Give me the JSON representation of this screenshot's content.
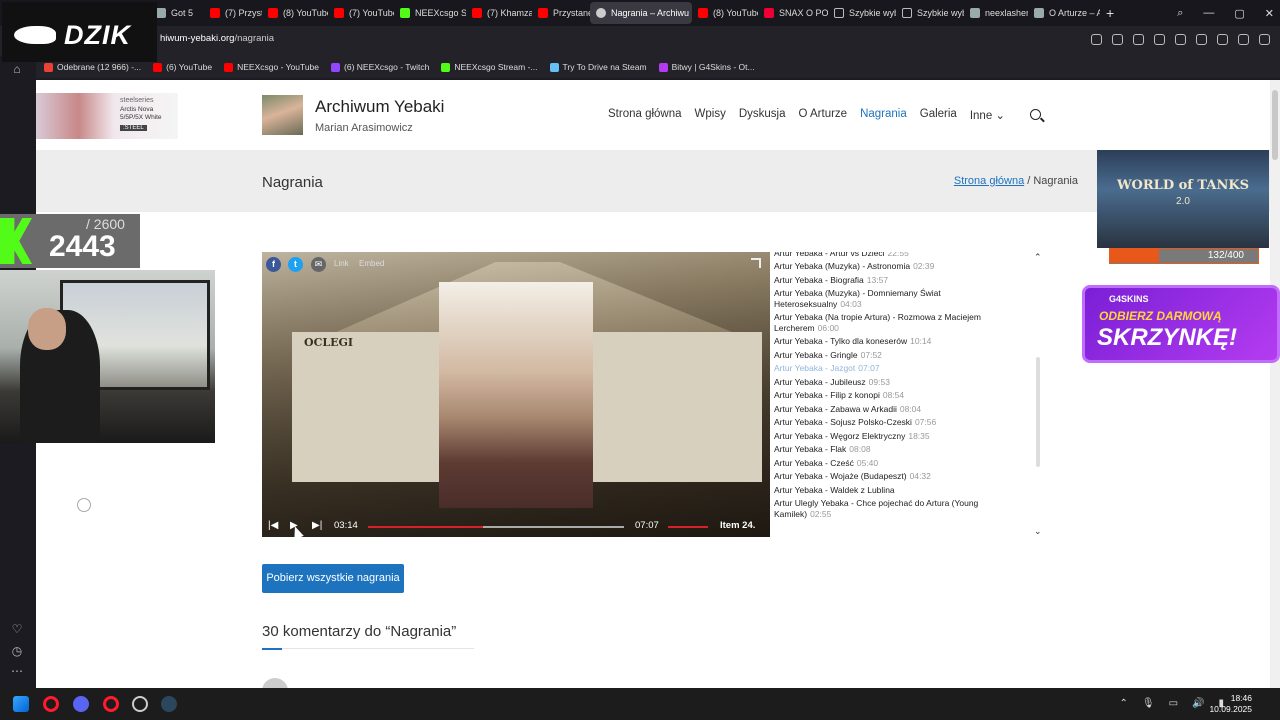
{
  "browser": {
    "tabs": [
      {
        "label": "Got 5",
        "icon": "web"
      },
      {
        "label": "(7) Przystanek",
        "icon": "yt"
      },
      {
        "label": "(8) YouTube",
        "icon": "yt"
      },
      {
        "label": "(7) YouTube",
        "icon": "yt"
      },
      {
        "label": "NEEXcsgo Str",
        "icon": "kick"
      },
      {
        "label": "(7) Khamzat C",
        "icon": "yt"
      },
      {
        "label": "Przystanek Lo",
        "icon": "yt"
      },
      {
        "label": "Nagrania – Archiwu",
        "icon": "spk",
        "active": true
      },
      {
        "label": "(8) YouTube",
        "icon": "yt"
      },
      {
        "label": "SNAX O POW",
        "icon": "snax"
      },
      {
        "label": "Szybkie wybie",
        "icon": "grid"
      },
      {
        "label": "Szybkie wybie",
        "icon": "grid"
      },
      {
        "label": "neexlasher sta",
        "icon": "web"
      },
      {
        "label": "O Arturze – A",
        "icon": "web"
      }
    ],
    "new_tab": "+",
    "url_prefix": "",
    "url_domain": "hiwum-yebaki.org",
    "url_path": "/nagrania",
    "bookmarks": [
      {
        "label": "Odebrane (12 966) -...",
        "color": "#ea4335"
      },
      {
        "label": "(6) YouTube",
        "color": "#ff0000"
      },
      {
        "label": "NEEXcsgo - YouTube",
        "color": "#ff0000"
      },
      {
        "label": "(6) NEEXcsgo - Twitch",
        "color": "#9146ff"
      },
      {
        "label": "NEEXcsgo Stream -...",
        "color": "#53fc18"
      },
      {
        "label": "Try To Drive na Steam",
        "color": "#66c0f4"
      },
      {
        "label": "Bitwy | G4Skins - Ot...",
        "color": "#b43cf0"
      }
    ]
  },
  "site": {
    "title": "Archiwum Yebaki",
    "subtitle": "Marian Arasimowicz",
    "nav": [
      {
        "label": "Strona główna"
      },
      {
        "label": "Wpisy"
      },
      {
        "label": "Dyskusja"
      },
      {
        "label": "O Arturze"
      },
      {
        "label": "Nagrania",
        "current": true
      },
      {
        "label": "Galeria"
      },
      {
        "label": "Inne ⌄"
      }
    ],
    "page_title": "Nagrania",
    "breadcrumb_home": "Strona główna",
    "breadcrumb_sep": " / ",
    "breadcrumb_current": "Nagrania",
    "download_label": "Pobierz wszystkie nagrania",
    "comments_title": "30 komentarzy do “Nagrania”"
  },
  "player": {
    "share_link": "Link",
    "share_embed": "Embed",
    "sign_text": "OCLEGI",
    "time_current": "03:14",
    "time_duration": "07:07",
    "progress": 0.45,
    "item_label": "Item 24."
  },
  "playlist": [
    {
      "title": "Artur Yebaka - Artur vs Dzieci",
      "dur": "22:55"
    },
    {
      "title": "Artur Yebaka (Muzyka) - Astronomia",
      "dur": "02:39"
    },
    {
      "title": "Artur Yebaka - Biografia",
      "dur": "13:57"
    },
    {
      "title": "Artur Yebaka (Muzyka) - Domniemany Świat Heteroseksualny",
      "dur": "04:03"
    },
    {
      "title": "Artur Yebaka (Na tropie Artura) - Rozmowa z Maciejem Lercherem",
      "dur": "06:00"
    },
    {
      "title": "Artur Yebaka - Tylko dla koneserów",
      "dur": "10:14"
    },
    {
      "title": "Artur Yebaka - Gringle",
      "dur": "07:52"
    },
    {
      "title": "Artur Yebaka - Jazgot",
      "dur": "07:07",
      "active": true
    },
    {
      "title": "Artur Yebaka - Jubileusz",
      "dur": "09:53"
    },
    {
      "title": "Artur Yebaka - Filip z konopi",
      "dur": "08:54"
    },
    {
      "title": "Artur Yebaka - Zabawa w Arkadii",
      "dur": "08:04"
    },
    {
      "title": "Artur Yebaka - Sojusz Polsko-Czeski",
      "dur": "07:56"
    },
    {
      "title": "Artur Yebaka - Węgorz Elektryczny",
      "dur": "18:35"
    },
    {
      "title": "Artur Yebaka - Flak",
      "dur": "08:08"
    },
    {
      "title": "Artur Yebaka - Cześć",
      "dur": "05:40"
    },
    {
      "title": "Artur Yebaka - Wojaże (Budapeszt)",
      "dur": "04:32"
    },
    {
      "title": "Artur Yebaka - Waldek z Lublina",
      "dur": ""
    },
    {
      "title": "Artur Ulegly Yebaka - Chce pojechać do Artura (Young Kamilek)",
      "dur": "02:55"
    }
  ],
  "ads": {
    "steelseries_brand": "steelseries",
    "steelseries_product": "Arctis Nova 5/5P/5X White",
    "steelseries_tag": ":STEEL",
    "wot_title": "WORLD of TANKS",
    "wot_version": "2.0",
    "wot_progress_text": "132/400",
    "wot_progress": 0.33,
    "g4_logo": "G4SKINS",
    "g4_line1": "ODBIERZ DARMOWĄ",
    "g4_line2": "SKRZYNKĘ!"
  },
  "stream": {
    "logo_text": "DZIK",
    "counter_max": "/ 2600",
    "counter_value": "2443"
  },
  "taskbar": {
    "time": "18:46",
    "date": "10.09.2025"
  },
  "colors": {
    "accent": "#1e73be",
    "progress": "#d6202a",
    "kick": "#53fc18"
  }
}
